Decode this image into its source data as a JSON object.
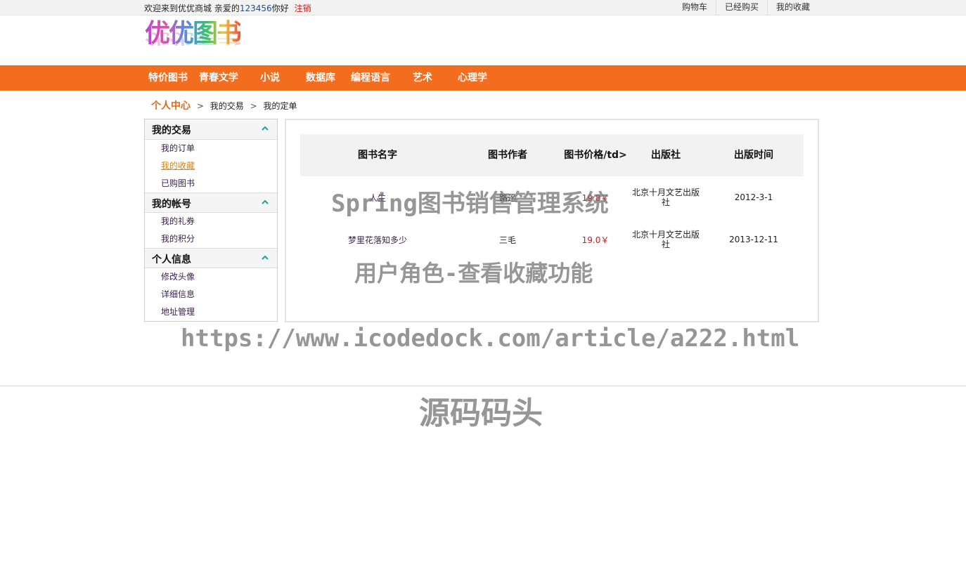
{
  "topbar": {
    "welcome_prefix": "欢迎来到优优商城   亲爱的",
    "username": "123456",
    "welcome_suffix": "你好",
    "logout_label": "注销",
    "links": [
      "购物车",
      "已经购买",
      "我的收藏"
    ]
  },
  "logo": {
    "text": "优优图书"
  },
  "nav": {
    "items": [
      "特价图书",
      "青春文学",
      "小说",
      "数据库",
      "编程语言",
      "艺术",
      "心理学"
    ]
  },
  "breadcrumb": {
    "home": "个人中心",
    "separator": ">",
    "level1": "我的交易",
    "level2": "我的定单"
  },
  "sidebar": {
    "groups": [
      {
        "title": "我的交易",
        "items": [
          "我的订单",
          "我的收藏",
          "已购图书"
        ],
        "active": "我的收藏"
      },
      {
        "title": "我的帐号",
        "items": [
          "我的礼券",
          "我的积分"
        ]
      },
      {
        "title": "个人信息",
        "items": [
          "修改头像",
          "详细信息",
          "地址管理"
        ]
      }
    ]
  },
  "table": {
    "headers": [
      "图书名字",
      "图书作者",
      "图书价格/td>",
      "出版社",
      "出版时间"
    ],
    "rows": [
      {
        "name": "人生",
        "author": "路遥",
        "price": "19.8￥",
        "publisher": "北京十月文艺出版社",
        "date": "2012-3-1"
      },
      {
        "name": "梦里花落知多少",
        "author": "三毛",
        "price": "19.0￥",
        "publisher": "北京十月文艺出版社",
        "date": "2013-12-11"
      }
    ]
  },
  "watermarks": {
    "line1": "Spring图书销售管理系统",
    "line2": "用户角色-查看收藏功能",
    "line3": "https://www.icodedock.com/article/a222.html",
    "line4": "源码码头"
  },
  "colors": {
    "nav_bg": "#f36d1e",
    "accent_orange": "#e06a18",
    "price_red": "#c81d1d",
    "active_link": "#d98612"
  },
  "icons": {
    "collapse": "chevron-up-icon"
  }
}
